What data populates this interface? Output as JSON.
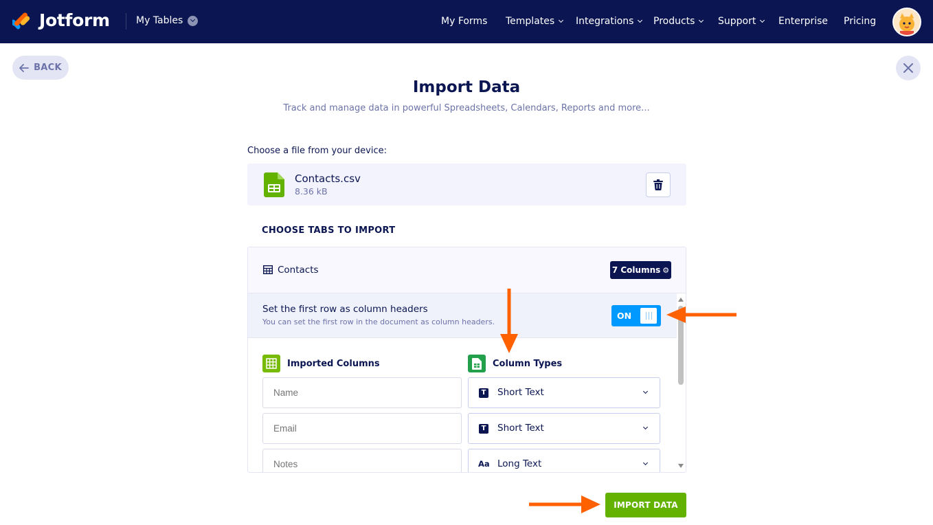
{
  "header": {
    "brand": "Jotform",
    "workspace": "My Tables",
    "nav": [
      {
        "label": "My Forms",
        "dropdown": false
      },
      {
        "label": "Templates",
        "dropdown": true
      },
      {
        "label": "Integrations",
        "dropdown": true
      },
      {
        "label": "Products",
        "dropdown": true
      },
      {
        "label": "Support",
        "dropdown": true
      },
      {
        "label": "Enterprise",
        "dropdown": false
      },
      {
        "label": "Pricing",
        "dropdown": false
      }
    ]
  },
  "back_label": "BACK",
  "page": {
    "title": "Import Data",
    "subtitle": "Track and manage data in powerful Spreadsheets, Calendars, Reports and more..."
  },
  "file": {
    "choose_label": "Choose a file from your device:",
    "name": "Contacts.csv",
    "size": "8.36 kB"
  },
  "tabs": {
    "heading": "CHOOSE TABS TO IMPORT",
    "tab_name": "Contacts",
    "columns_badge": "7 Columns"
  },
  "header_row": {
    "title": "Set the first row as column headers",
    "description": "You can set the first row in the document as column headers.",
    "toggle": "ON"
  },
  "columns": {
    "imported_heading": "Imported Columns",
    "types_heading": "Column Types",
    "rows": [
      {
        "placeholder": "Name",
        "type": "Short Text",
        "type_icon": "T"
      },
      {
        "placeholder": "Email",
        "type": "Short Text",
        "type_icon": "T"
      },
      {
        "placeholder": "Notes",
        "type": "Long Text",
        "type_icon": "Aa"
      }
    ]
  },
  "import_button": "IMPORT DATA",
  "colors": {
    "navy": "#0a1551",
    "toggle_blue": "#0099ff",
    "import_green": "#64b200",
    "annotation_orange": "#ff6100"
  }
}
